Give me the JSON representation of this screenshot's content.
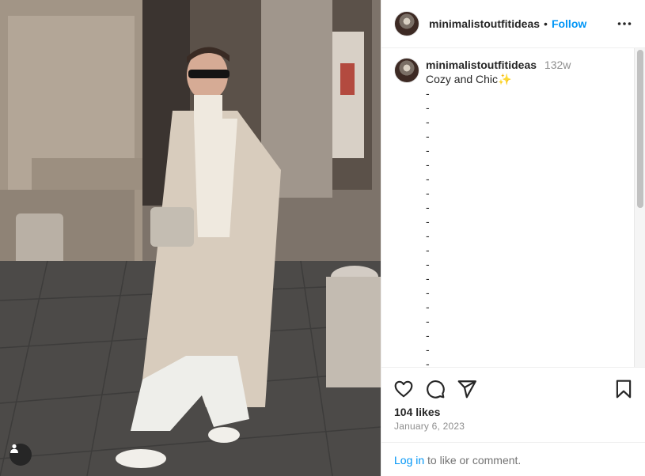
{
  "post": {
    "username": "minimalistoutfitideas",
    "follow_label": "Follow",
    "separator": "•",
    "comment": {
      "username": "minimalistoutfitideas",
      "age": "132w",
      "caption": "Cozy and Chic✨",
      "dash_lines": "-\n-\n-\n-\n-\n-\n-\n-\n-\n-\n-\n-\n-\n-\n-\n-\n-\n-\n-\n-\n-"
    },
    "likes": "104 likes",
    "date": "January 6, 2023",
    "login": {
      "link": "Log in",
      "rest": " to like or comment."
    }
  },
  "icons": {
    "more": "more-options-icon",
    "like": "heart-icon",
    "comment": "comment-icon",
    "share": "share-icon",
    "save": "bookmark-icon",
    "tag": "user-tag-icon"
  },
  "colors": {
    "accent": "#0095f6",
    "text": "#262626",
    "muted": "#8e8e8e"
  }
}
